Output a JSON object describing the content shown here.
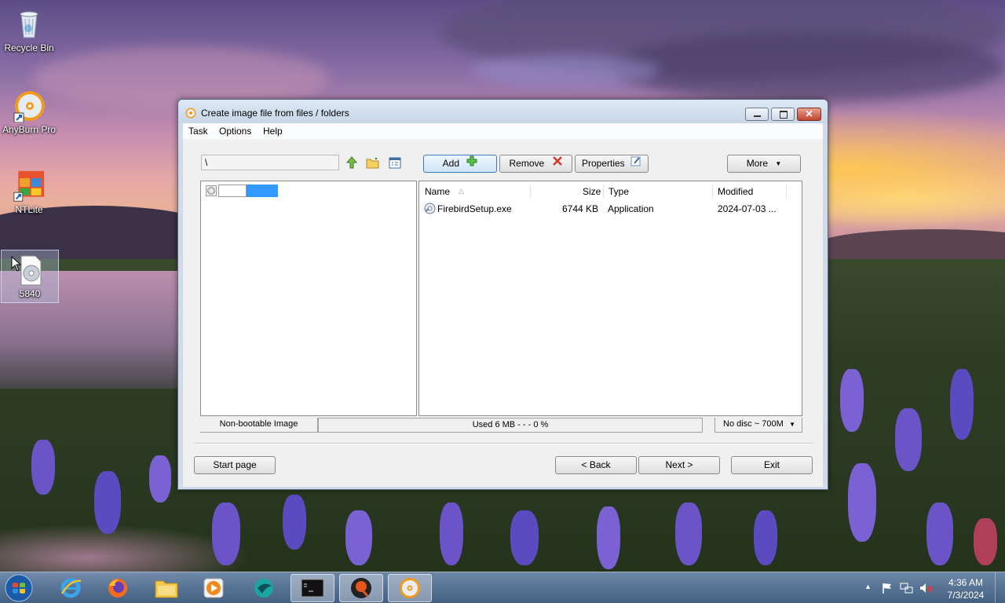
{
  "desktop": {
    "icons": [
      {
        "label": "Recycle Bin"
      },
      {
        "label": "AnyBurn Pro"
      },
      {
        "label": "NTLite"
      },
      {
        "label": "5840"
      }
    ]
  },
  "window": {
    "title": "Create image file from files / folders",
    "menu": [
      "Task",
      "Options",
      "Help"
    ],
    "path": "\\",
    "toolbar": {
      "add": "Add",
      "remove": "Remove",
      "properties": "Properties",
      "more": "More"
    },
    "list": {
      "columns": [
        "Name",
        "Size",
        "Type",
        "Modified"
      ],
      "rows": [
        {
          "name": "FirebirdSetup.exe",
          "size": "6744 KB",
          "type": "Application",
          "modified": "2024-07-03 ..."
        }
      ]
    },
    "status": {
      "boot": "Non-bootable Image",
      "used": "Used  6 MB   - - -  0 %",
      "disc": "No disc ~ 700M"
    },
    "buttons": {
      "start_page": "Start page",
      "back": "< Back",
      "next": "Next >",
      "exit": "Exit"
    }
  },
  "taskbar": {
    "clock_time": "4:36 AM",
    "clock_date": "7/3/2024"
  }
}
